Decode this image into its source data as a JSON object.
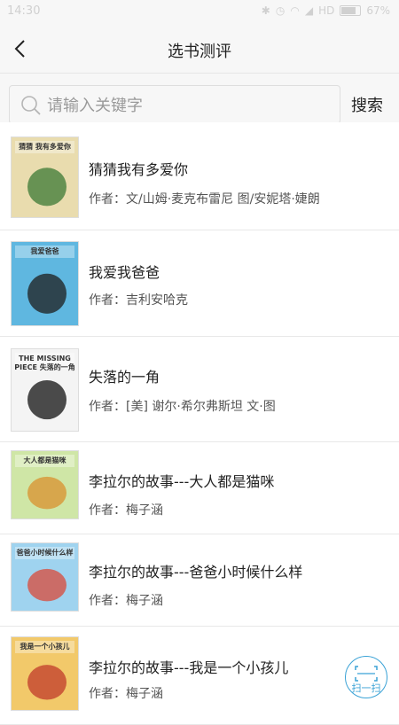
{
  "status": {
    "time": "14:30",
    "battery": "67%",
    "network": "HD"
  },
  "header": {
    "title": "选书测评",
    "back_icon": "back-arrow-icon"
  },
  "search": {
    "placeholder": "请输入关键字",
    "value": "",
    "button": "搜索"
  },
  "books": [
    {
      "title": "猜猜我有多爱你",
      "author": "作者：文/山姆·麦克布雷尼 图/安妮塔·婕朗",
      "cover_text": "猜猜 我有多爱你",
      "cover_bg": "#e9dcae",
      "cover_accent": "#3b7a34"
    },
    {
      "title": "我爱我爸爸",
      "author": "作者：吉利安哈克",
      "cover_text": "我爱爸爸",
      "cover_bg": "#5fb7e0",
      "cover_accent": "#1d1d1d"
    },
    {
      "title": "失落的一角",
      "author": "作者：[美] 谢尔·希尔弗斯坦 文·图",
      "cover_text": "THE MISSING PIECE 失落的一角",
      "cover_bg": "#f4f4f4",
      "cover_accent": "#111111"
    },
    {
      "title": "李拉尔的故事---大人都是猫咪",
      "author": "作者：梅子涵",
      "cover_text": "大人都是猫咪",
      "cover_bg": "#cfe6a6",
      "cover_accent": "#d9902e"
    },
    {
      "title": "李拉尔的故事---爸爸小时候什么样",
      "author": "作者：梅子涵",
      "cover_text": "爸爸小时候什么样",
      "cover_bg": "#9fd3ef",
      "cover_accent": "#d94a3a"
    },
    {
      "title": "李拉尔的故事---我是一个小孩儿",
      "author": "作者：梅子涵",
      "cover_text": "我是一个小孩儿",
      "cover_bg": "#f2c96a",
      "cover_accent": "#c0392b"
    }
  ],
  "scan_button": {
    "label": "扫一扫",
    "color": "#3aa2d6"
  }
}
